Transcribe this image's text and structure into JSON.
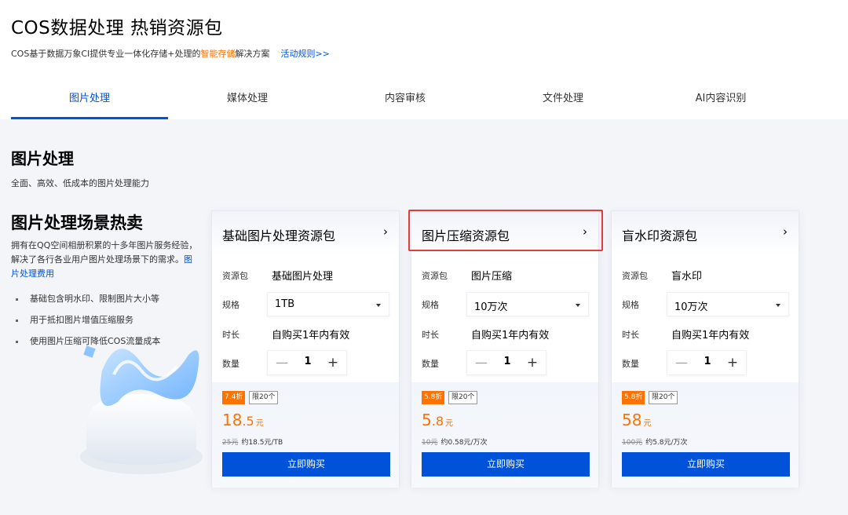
{
  "header": {
    "title": "COS数据处理 热销资源包",
    "subtitle_prefix": "COS基于数据万象CI提供专业一体化存储+处理的",
    "subtitle_highlight": "智能存储",
    "subtitle_suffix": "解决方案",
    "rules_link": "活动规则>>"
  },
  "tabs": [
    {
      "label": "图片处理",
      "active": true
    },
    {
      "label": "媒体处理",
      "active": false
    },
    {
      "label": "内容审核",
      "active": false
    },
    {
      "label": "文件处理",
      "active": false
    },
    {
      "label": "AI内容识别",
      "active": false
    }
  ],
  "section": {
    "title": "图片处理",
    "desc": "全面、高效、低成本的图片处理能力"
  },
  "left": {
    "title": "图片处理场景热卖",
    "desc": "拥有在QQ空间相册积累的十多年图片服务经验，解决了各行各业用户图片处理场景下的需求。",
    "fee_link": "图片处理费用",
    "bullets": [
      "基础包含明水印、限制图片大小等",
      "用于抵扣图片增值压缩服务",
      "使用图片压缩可降低COS流量成本"
    ]
  },
  "labels": {
    "package": "资源包",
    "spec": "规格",
    "duration": "时长",
    "quantity": "数量",
    "duration_value": "自购买1年内有效",
    "buy": "立即购买",
    "limit": "限20个",
    "yuan": "元",
    "minus": "—",
    "plus": "+",
    "arrow": "›"
  },
  "cards": [
    {
      "name": "基础图片处理资源包",
      "package": "基础图片处理",
      "spec": "1TB",
      "quantity": "1",
      "discount": "7.4折",
      "price_int": "18",
      "price_dec": ".5",
      "orig_price": "25元",
      "unit_price": "约18.5元/TB",
      "highlighted": false
    },
    {
      "name": "图片压缩资源包",
      "package": "图片压缩",
      "spec": "10万次",
      "quantity": "1",
      "discount": "5.8折",
      "price_int": "5",
      "price_dec": ".8",
      "orig_price": "10元",
      "unit_price": "约0.58元/万次",
      "highlighted": true
    },
    {
      "name": "盲水印资源包",
      "package": "盲水印",
      "spec": "10万次",
      "quantity": "1",
      "discount": "5.8折",
      "price_int": "58",
      "price_dec": "",
      "orig_price": "100元",
      "unit_price": "约5.8元/万次",
      "highlighted": false
    }
  ],
  "colors": {
    "accent": "#0052d9",
    "highlight": "#ff7200",
    "annotation_box": "#e23c3c"
  }
}
